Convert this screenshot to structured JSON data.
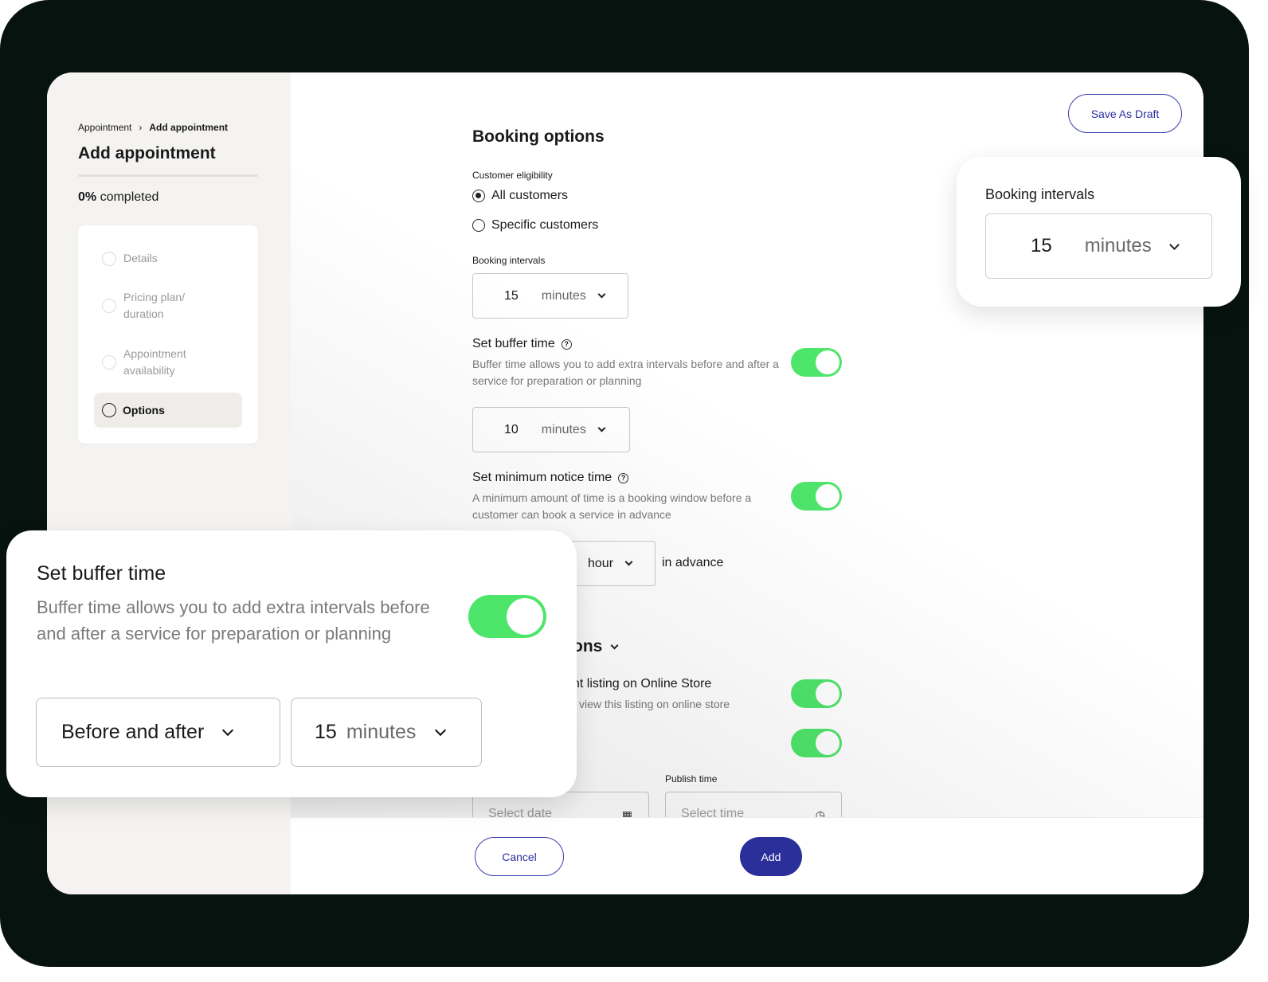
{
  "breadcrumb": {
    "parent": "Appointment",
    "separator": "›",
    "current": "Add appointment"
  },
  "page_title": "Add appointment",
  "progress": {
    "percent": "0%",
    "label": "completed"
  },
  "steps": [
    {
      "label_line1": "Details",
      "label_line2": ""
    },
    {
      "label_line1": "Pricing plan/",
      "label_line2": "duration"
    },
    {
      "label_line1": "Appointment",
      "label_line2": "availability"
    }
  ],
  "active_step": "Options",
  "save_draft": "Save As Draft",
  "booking": {
    "title": "Booking options",
    "eligibility_label": "Customer eligibility",
    "eligibility_options": [
      "All customers",
      "Specific customers"
    ],
    "eligibility_selected": "All customers",
    "intervals_label": "Booking intervals",
    "intervals_value": "15",
    "intervals_unit": "minutes"
  },
  "buffer": {
    "title": "Set buffer time",
    "desc": "Buffer time allows you to add extra intervals before and after a service for preparation or planning",
    "enabled": true,
    "value": "10",
    "unit": "minutes"
  },
  "notice": {
    "title": "Set minimum notice time",
    "desc": "A minimum amount of time is a booking window before a customer can book a service in advance",
    "enabled": true,
    "unit": "hour",
    "suffix": "in advance"
  },
  "partial": {
    "section_fragment": "ons",
    "listing_title_fragment": "nt listing on Online Store",
    "listing_desc_fragment": "view this listing on online store",
    "publish_time_label": "Publish time",
    "date_placeholder": "Select date",
    "time_placeholder": "Select time"
  },
  "footer": {
    "cancel": "Cancel",
    "add": "Add"
  },
  "callout_intervals": {
    "label": "Booking intervals",
    "value": "15",
    "unit": "minutes"
  },
  "callout_buffer": {
    "title": "Set buffer time",
    "desc": "Buffer time allows you to add extra intervals before and after a service for preparation or planning",
    "mode": "Before and after",
    "value": "15",
    "unit": "minutes",
    "enabled": true
  },
  "colors": {
    "toggle_on": "#4ee56b",
    "primary": "#2a2f9a",
    "frame": "#07130f"
  },
  "icons": [
    "chevron-right-icon",
    "info-icon",
    "chevron-down-icon",
    "calendar-icon",
    "clock-icon"
  ]
}
